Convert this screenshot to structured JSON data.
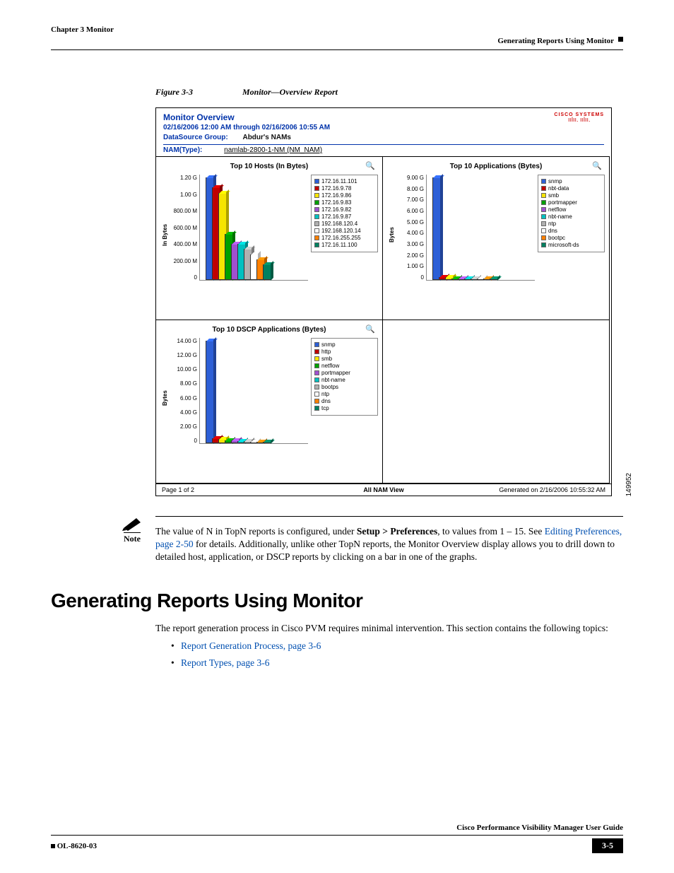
{
  "header": {
    "chapter": "Chapter 3      Monitor",
    "section": "Generating Reports Using Monitor"
  },
  "figure": {
    "caption_num": "Figure 3-3",
    "caption_txt": "Monitor—Overview Report",
    "title": "Monitor Overview",
    "dateline": "02/16/2006 12:00 AM through 02/16/2006 10:55 AM",
    "dsg_label": "DataSource Group:",
    "dsg_value": "Abdur's NAMs",
    "nam_label": "NAM(Type):",
    "nam_value": "namlab-2800-1-NM (NM_NAM)",
    "cisco": "CISCO SYSTEMS",
    "footer_left": "Page 1 of 2",
    "footer_center": "All NAM View",
    "footer_right": "Generated on    2/16/2006 10:55:32 AM",
    "side_number": "149952"
  },
  "chart_data": [
    {
      "type": "bar",
      "title": "Top 10 Hosts (In Bytes)",
      "ylabel": "In Bytes",
      "ticks": [
        "1.20 G",
        "1.00 G",
        "800.00 M",
        "600.00 M",
        "400.00 M",
        "200.00 M",
        "0"
      ],
      "ylim": [
        0,
        1200000000
      ],
      "series": [
        {
          "name": "172.16.11.101",
          "value": 1200000000,
          "color": "#2d5fd6"
        },
        {
          "name": "172.16.9.78",
          "value": 1080000000,
          "color": "#c00000"
        },
        {
          "name": "172.16.9.86",
          "value": 1020000000,
          "color": "#f6e500"
        },
        {
          "name": "172.16.9.83",
          "value": 540000000,
          "color": "#00a000"
        },
        {
          "name": "172.16.9.82",
          "value": 420000000,
          "color": "#a050d0"
        },
        {
          "name": "172.16.9.87",
          "value": 420000000,
          "color": "#00c0c0"
        },
        {
          "name": "192.168.120.4",
          "value": 360000000,
          "color": "#b0b0b0"
        },
        {
          "name": "192.168.120.14",
          "value": 300000000,
          "color": "#ffffff"
        },
        {
          "name": "172.16.255.255",
          "value": 240000000,
          "color": "#ff8000"
        },
        {
          "name": "172.16.11.100",
          "value": 180000000,
          "color": "#008060"
        }
      ]
    },
    {
      "type": "bar",
      "title": "Top 10 Applications (Bytes)",
      "ylabel": "Bytes",
      "ticks": [
        "9.00 G",
        "8.00 G",
        "7.00 G",
        "6.00 G",
        "5.00 G",
        "4.00 G",
        "3.00 G",
        "2.00 G",
        "1.00 G",
        "0"
      ],
      "ylim": [
        0,
        9000000000
      ],
      "series": [
        {
          "name": "snmp",
          "value": 9000000000,
          "color": "#2d5fd6"
        },
        {
          "name": "nbt-data",
          "value": 270000000,
          "color": "#c00000"
        },
        {
          "name": "smb",
          "value": 225000000,
          "color": "#f6e500"
        },
        {
          "name": "portmapper",
          "value": 135000000,
          "color": "#00a000"
        },
        {
          "name": "netflow",
          "value": 135000000,
          "color": "#a050d0"
        },
        {
          "name": "nbt-name",
          "value": 90000000,
          "color": "#00c0c0"
        },
        {
          "name": "ntp",
          "value": 90000000,
          "color": "#b0b0b0"
        },
        {
          "name": "dns",
          "value": 45000000,
          "color": "#ffffff"
        },
        {
          "name": "bootpc",
          "value": 45000000,
          "color": "#ff8000"
        },
        {
          "name": "microsoft-ds",
          "value": 45000000,
          "color": "#008060"
        }
      ]
    },
    {
      "type": "bar",
      "title": "Top 10 DSCP Applications (Bytes)",
      "ylabel": "Bytes",
      "ticks": [
        "14.00 G",
        "12.00 G",
        "10.00 G",
        "8.00 G",
        "6.00 G",
        "4.00 G",
        "2.00 G",
        "0"
      ],
      "ylim": [
        0,
        14000000000
      ],
      "series": [
        {
          "name": "snmp",
          "value": 14000000000,
          "color": "#2d5fd6"
        },
        {
          "name": "http",
          "value": 700000000,
          "color": "#c00000"
        },
        {
          "name": "smb",
          "value": 560000000,
          "color": "#f6e500"
        },
        {
          "name": "netflow",
          "value": 420000000,
          "color": "#00a000"
        },
        {
          "name": "portmapper",
          "value": 350000000,
          "color": "#a050d0"
        },
        {
          "name": "nbt-name",
          "value": 280000000,
          "color": "#00c0c0"
        },
        {
          "name": "bootps",
          "value": 280000000,
          "color": "#b0b0b0"
        },
        {
          "name": "ntp",
          "value": 210000000,
          "color": "#ffffff"
        },
        {
          "name": "dns",
          "value": 210000000,
          "color": "#ff8000"
        },
        {
          "name": "tcp",
          "value": 140000000,
          "color": "#008060"
        }
      ]
    }
  ],
  "note": {
    "label": "Note",
    "pre": "The value of N in TopN reports is configured, under ",
    "bold": "Setup > Preferences",
    "mid": ", to values from 1 – 15. See ",
    "link": "Editing Preferences, page 2-50",
    "post": " for details. Additionally, unlike other TopN reports, the Monitor Overview display allows you to drill down to detailed host, application, or DSCP reports by clicking on a bar in one of the graphs."
  },
  "section": {
    "heading": "Generating Reports Using Monitor",
    "intro": "The report generation process in Cisco PVM requires minimal intervention. This section contains the following topics:",
    "links": [
      "Report Generation Process, page 3-6",
      "Report Types, page 3-6"
    ]
  },
  "footer": {
    "guide": "Cisco Performance Visibility Manager User Guide",
    "doc": "OL-8620-03",
    "page": "3-5"
  }
}
